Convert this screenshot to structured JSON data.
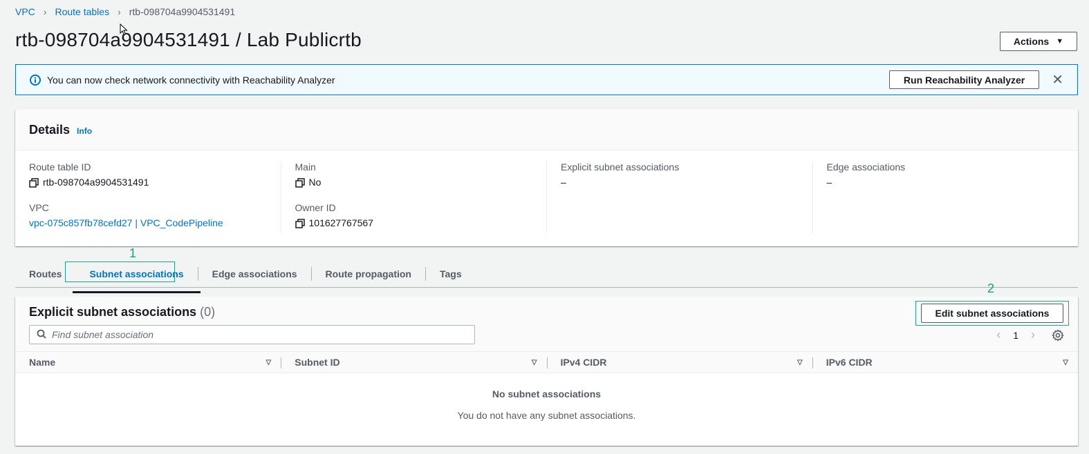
{
  "breadcrumb": {
    "items": [
      "VPC",
      "Route tables"
    ],
    "current": "rtb-098704a9904531491"
  },
  "page_title": "rtb-098704a9904531491 / Lab Publicrtb",
  "actions_label": "Actions",
  "flash": {
    "message": "You can now check network connectivity with Reachability Analyzer",
    "button": "Run Reachability Analyzer",
    "close": "✕"
  },
  "details": {
    "title": "Details",
    "info": "Info",
    "route_table_id_label": "Route table ID",
    "route_table_id": "rtb-098704a9904531491",
    "vpc_label": "VPC",
    "vpc_value": "vpc-075c857fb78cefd27 | VPC_CodePipeline",
    "main_label": "Main",
    "main_value": "No",
    "owner_label": "Owner ID",
    "owner_value": "101627767567",
    "explicit_label": "Explicit subnet associations",
    "explicit_value": "–",
    "edge_label": "Edge associations",
    "edge_value": "–"
  },
  "tabs": [
    "Routes",
    "Subnet associations",
    "Edge associations",
    "Route propagation",
    "Tags"
  ],
  "markers": {
    "one": "1",
    "two": "2"
  },
  "subnet_panel": {
    "title": "Explicit subnet associations",
    "count": "(0)",
    "edit_button": "Edit subnet associations",
    "search_placeholder": "Find subnet association",
    "page": "1",
    "columns": [
      "Name",
      "Subnet ID",
      "IPv4 CIDR",
      "IPv6 CIDR"
    ],
    "empty_title": "No subnet associations",
    "empty_text": "You do not have any subnet associations."
  },
  "colors": {
    "link": "#0073bb",
    "highlight": "#21a08d",
    "info_bg": "#f1faff"
  }
}
